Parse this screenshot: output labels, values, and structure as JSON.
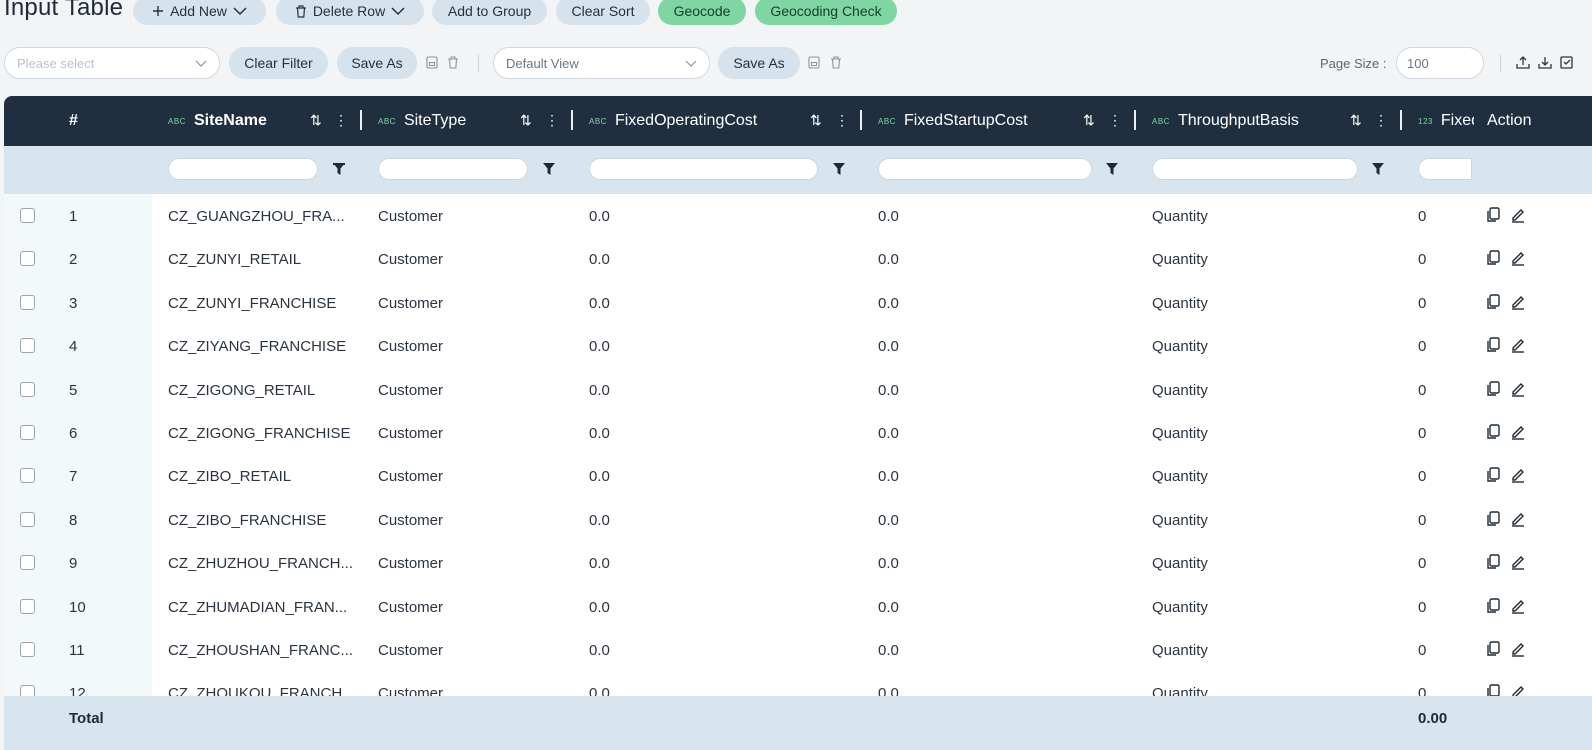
{
  "title": "Input Table",
  "toolbar": {
    "add_new": "Add New",
    "delete_row": "Delete Row",
    "add_to_group": "Add to Group",
    "clear_sort": "Clear Sort",
    "geocode": "Geocode",
    "geocoding_check": "Geocoding Check"
  },
  "filterbar": {
    "filter_placeholder": "Please select",
    "clear_filter": "Clear Filter",
    "save_as_1": "Save As",
    "view_value": "Default View",
    "save_as_2": "Save As",
    "page_size_label": "Page Size :",
    "page_size_value": "100"
  },
  "columns": {
    "index": "#",
    "site_name": {
      "type": "ABC",
      "label": "SiteName"
    },
    "site_type": {
      "type": "ABC",
      "label": "SiteType"
    },
    "fixed_operating_cost": {
      "type": "ABC",
      "label": "FixedOperatingCost"
    },
    "fixed_startup_cost": {
      "type": "ABC",
      "label": "FixedStartupCost"
    },
    "throughput_basis": {
      "type": "ABC",
      "label": "ThroughputBasis"
    },
    "fixed": {
      "type": "123",
      "label": "Fixed"
    },
    "action": "Action"
  },
  "rows": [
    {
      "n": "1",
      "site": "CZ_GUANGZHOU_FRA...",
      "type": "Customer",
      "op": "0.0",
      "start": "0.0",
      "basis": "Quantity",
      "fixed": "0"
    },
    {
      "n": "2",
      "site": "CZ_ZUNYI_RETAIL",
      "type": "Customer",
      "op": "0.0",
      "start": "0.0",
      "basis": "Quantity",
      "fixed": "0"
    },
    {
      "n": "3",
      "site": "CZ_ZUNYI_FRANCHISE",
      "type": "Customer",
      "op": "0.0",
      "start": "0.0",
      "basis": "Quantity",
      "fixed": "0"
    },
    {
      "n": "4",
      "site": "CZ_ZIYANG_FRANCHISE",
      "type": "Customer",
      "op": "0.0",
      "start": "0.0",
      "basis": "Quantity",
      "fixed": "0"
    },
    {
      "n": "5",
      "site": "CZ_ZIGONG_RETAIL",
      "type": "Customer",
      "op": "0.0",
      "start": "0.0",
      "basis": "Quantity",
      "fixed": "0"
    },
    {
      "n": "6",
      "site": "CZ_ZIGONG_FRANCHISE",
      "type": "Customer",
      "op": "0.0",
      "start": "0.0",
      "basis": "Quantity",
      "fixed": "0"
    },
    {
      "n": "7",
      "site": "CZ_ZIBO_RETAIL",
      "type": "Customer",
      "op": "0.0",
      "start": "0.0",
      "basis": "Quantity",
      "fixed": "0"
    },
    {
      "n": "8",
      "site": "CZ_ZIBO_FRANCHISE",
      "type": "Customer",
      "op": "0.0",
      "start": "0.0",
      "basis": "Quantity",
      "fixed": "0"
    },
    {
      "n": "9",
      "site": "CZ_ZHUZHOU_FRANCH...",
      "type": "Customer",
      "op": "0.0",
      "start": "0.0",
      "basis": "Quantity",
      "fixed": "0"
    },
    {
      "n": "10",
      "site": "CZ_ZHUMADIAN_FRAN...",
      "type": "Customer",
      "op": "0.0",
      "start": "0.0",
      "basis": "Quantity",
      "fixed": "0"
    },
    {
      "n": "11",
      "site": "CZ_ZHOUSHAN_FRANC...",
      "type": "Customer",
      "op": "0.0",
      "start": "0.0",
      "basis": "Quantity",
      "fixed": "0"
    },
    {
      "n": "12",
      "site": "CZ_ZHOUKOU_FRANCH...",
      "type": "Customer",
      "op": "0.0",
      "start": "0.0",
      "basis": "Quantity",
      "fixed": "0"
    }
  ],
  "footer": {
    "label": "Total",
    "fixed_total": "0.00"
  },
  "colors": {
    "header_bg": "#1f2f40",
    "accent_green": "#7fd6a3",
    "pill_bg": "#d6e2ec"
  },
  "icons": [
    "plus-icon",
    "chevron-down-icon",
    "trash-icon",
    "save-icon",
    "upload-icon",
    "download-icon",
    "sort-icon",
    "more-vertical-icon",
    "filter-icon",
    "copy-icon",
    "edit-icon",
    "checkbox"
  ]
}
